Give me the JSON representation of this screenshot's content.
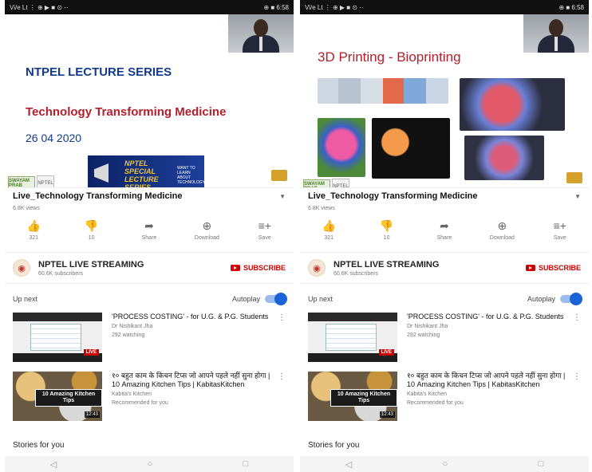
{
  "status_bar": {
    "left": "Vi/e Lt  ⋮ ⊕ ▶ ■ ⊙ ··",
    "right": "⊕ ■ 6:58"
  },
  "left": {
    "slide": {
      "series": "NTPEL LECTURE SERIES",
      "title": "Technology Transforming Medicine",
      "date": "26 04 2020",
      "banner_text": "NPTEL SPECIAL LECTURE SERIES",
      "banner_small": "WANT TO LEARN ABOUT TECHNOLOGY"
    }
  },
  "right": {
    "slide": {
      "title": "3D Printing - Bioprinting"
    }
  },
  "logos": {
    "swayam": "SWAYAM PRAB",
    "small": "NPTEL"
  },
  "video": {
    "title": "Live_Technology Transforming Medicine",
    "views": "6.8K views"
  },
  "actions": {
    "like": {
      "icon": "thumbs-up-icon",
      "label": "321"
    },
    "dislike": {
      "icon": "thumbs-down-icon",
      "label": "10"
    },
    "share": {
      "icon": "share-icon",
      "label": "Share"
    },
    "download": {
      "icon": "download-icon",
      "label": "Download"
    },
    "save": {
      "icon": "playlist-add-icon",
      "label": "Save"
    }
  },
  "channel": {
    "name": "NPTEL LIVE STREAMING",
    "subs": "60.6K subscribers",
    "subscribe": "SUBSCRIBE"
  },
  "upnext": {
    "label": "Up next",
    "autoplay": "Autoplay"
  },
  "recs": [
    {
      "title": "'PROCESS COSTING' - for U.G. & P.G. Students",
      "channel": "Dr Nishikant Jha",
      "meta": "292 watching",
      "badge": "LIVE"
    },
    {
      "title": "१० बहुत काम के किचन टिप्स जो आपने पहले नहीं सुना होगा | 10 Amazing Kitchen Tips | KabitasKitchen",
      "channel": "Kabita's Kitchen",
      "meta": "Recommended for you",
      "badge": "10 Amazing Kitchen Tips",
      "duration": "12:43"
    }
  ],
  "stories": "Stories for you",
  "nav": {
    "back": "◁",
    "home": "○",
    "recents": "□"
  },
  "colors": {
    "accent": "#1a63d6",
    "subscribe": "#cc0000",
    "slide_blue": "#123a8a",
    "slide_red": "#b3202c"
  }
}
